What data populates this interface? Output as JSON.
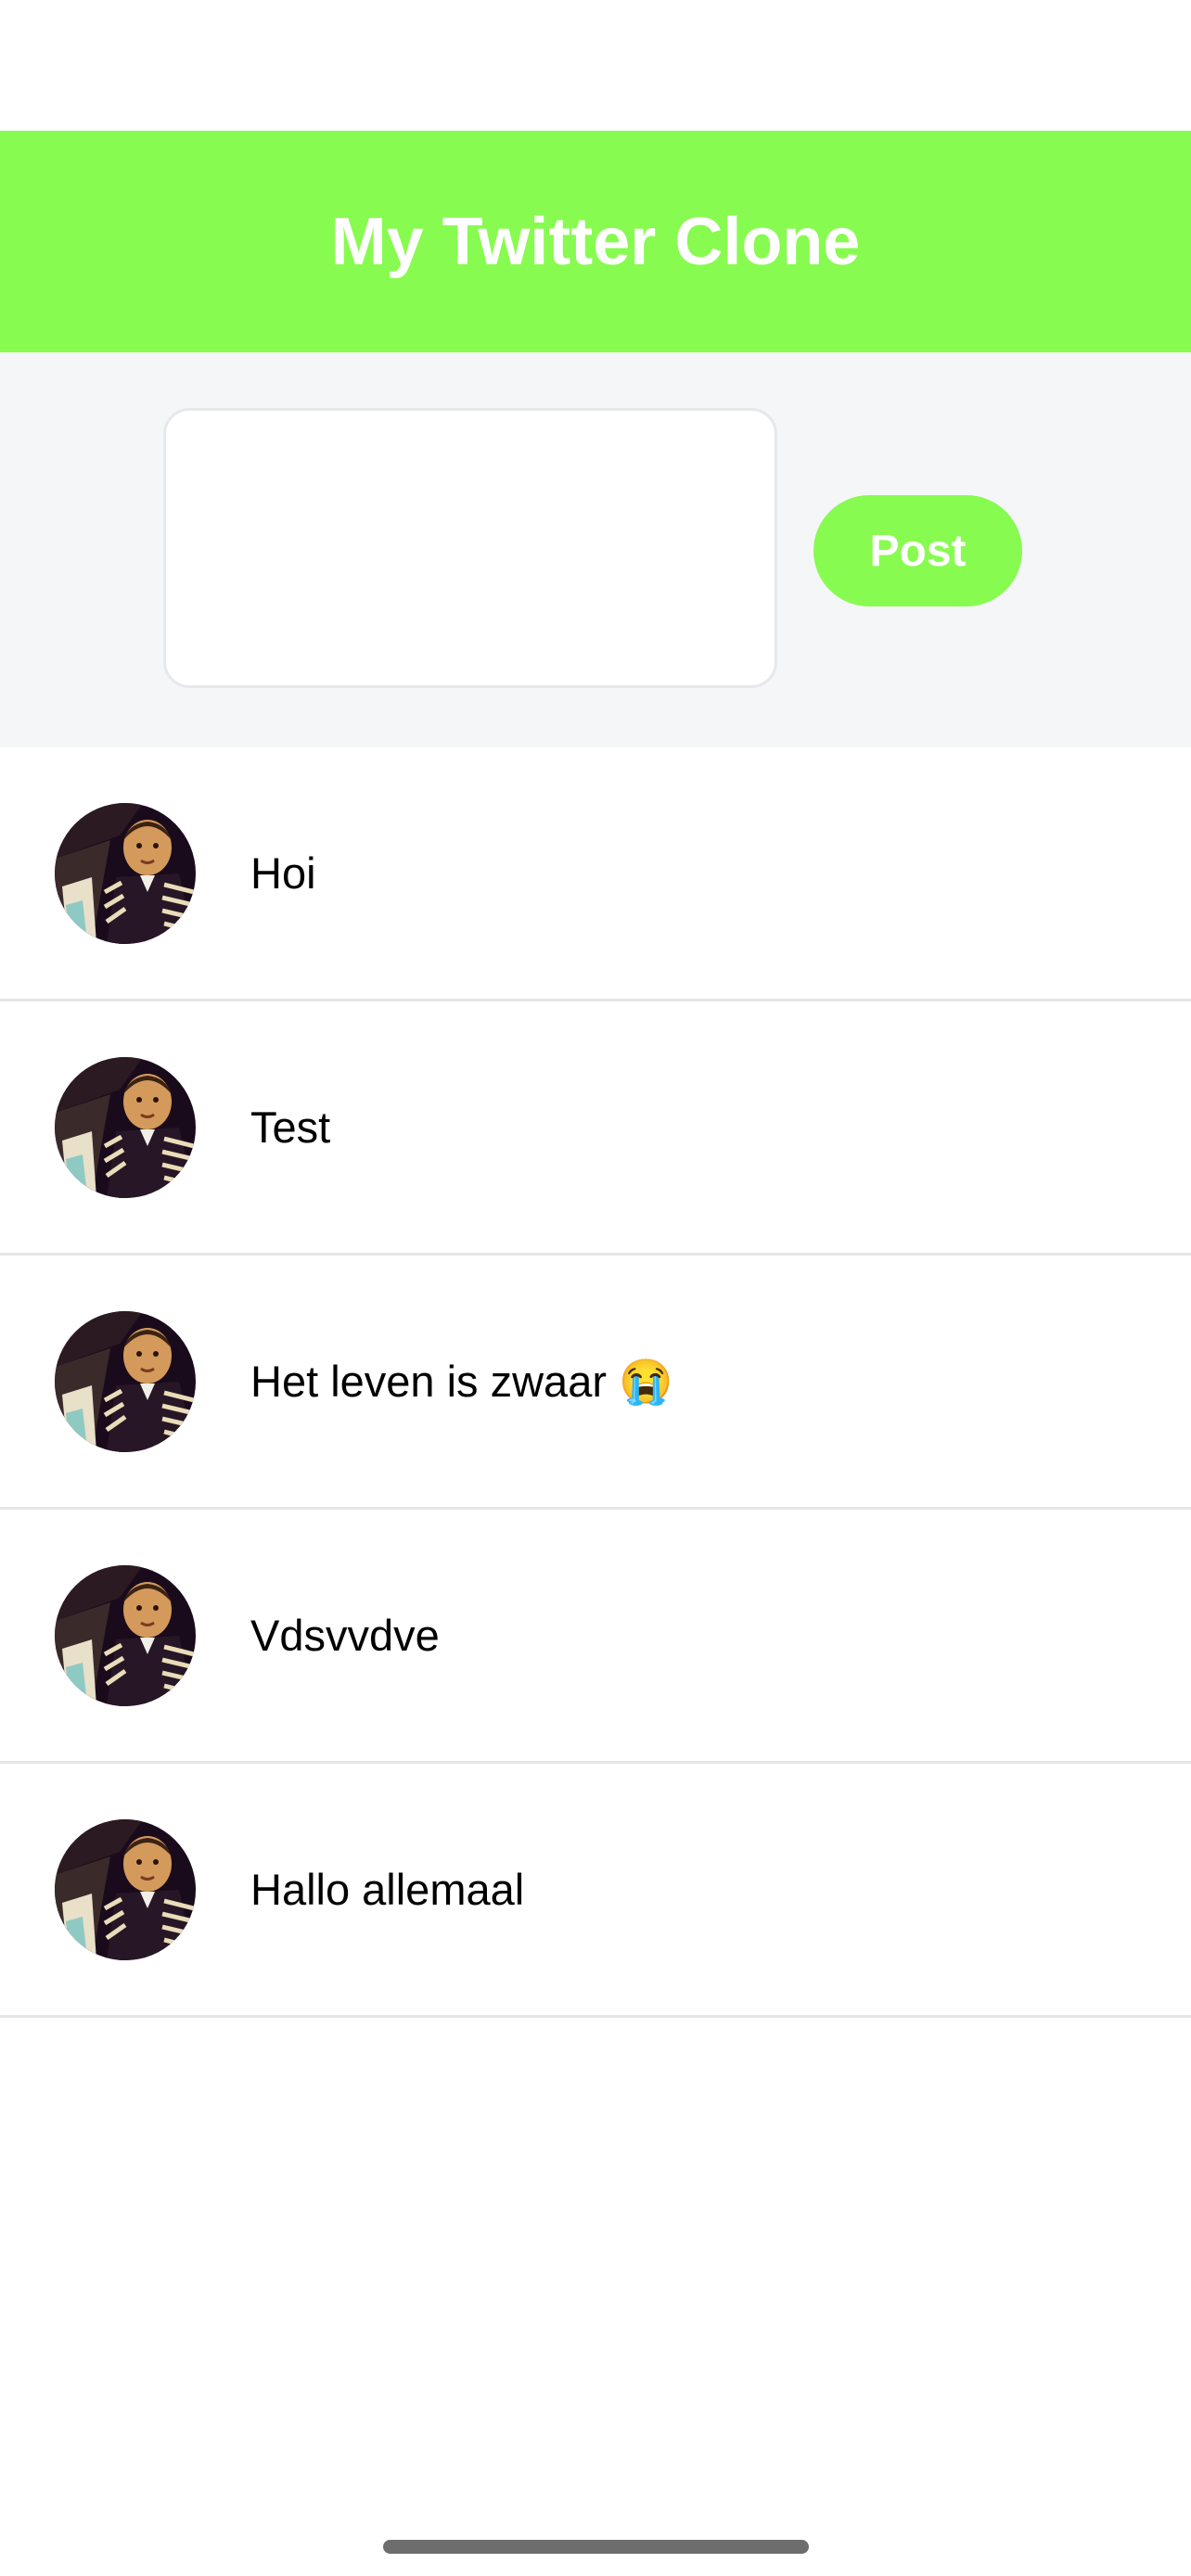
{
  "colors": {
    "accent": "#88fb50",
    "composer_bg": "#f4f6f8",
    "divider": "#e4e6e9"
  },
  "header": {
    "title": "My Twitter Clone"
  },
  "composer": {
    "input_value": "",
    "input_placeholder": "",
    "post_label": "Post"
  },
  "tweets": [
    {
      "text": "Hoi",
      "avatar": "user-avatar"
    },
    {
      "text": "Test",
      "avatar": "user-avatar"
    },
    {
      "text": "Het leven is zwaar 😭",
      "avatar": "user-avatar"
    },
    {
      "text": "Vdsvvdve",
      "avatar": "user-avatar"
    },
    {
      "text": "Hallo allemaal",
      "avatar": "user-avatar"
    }
  ]
}
